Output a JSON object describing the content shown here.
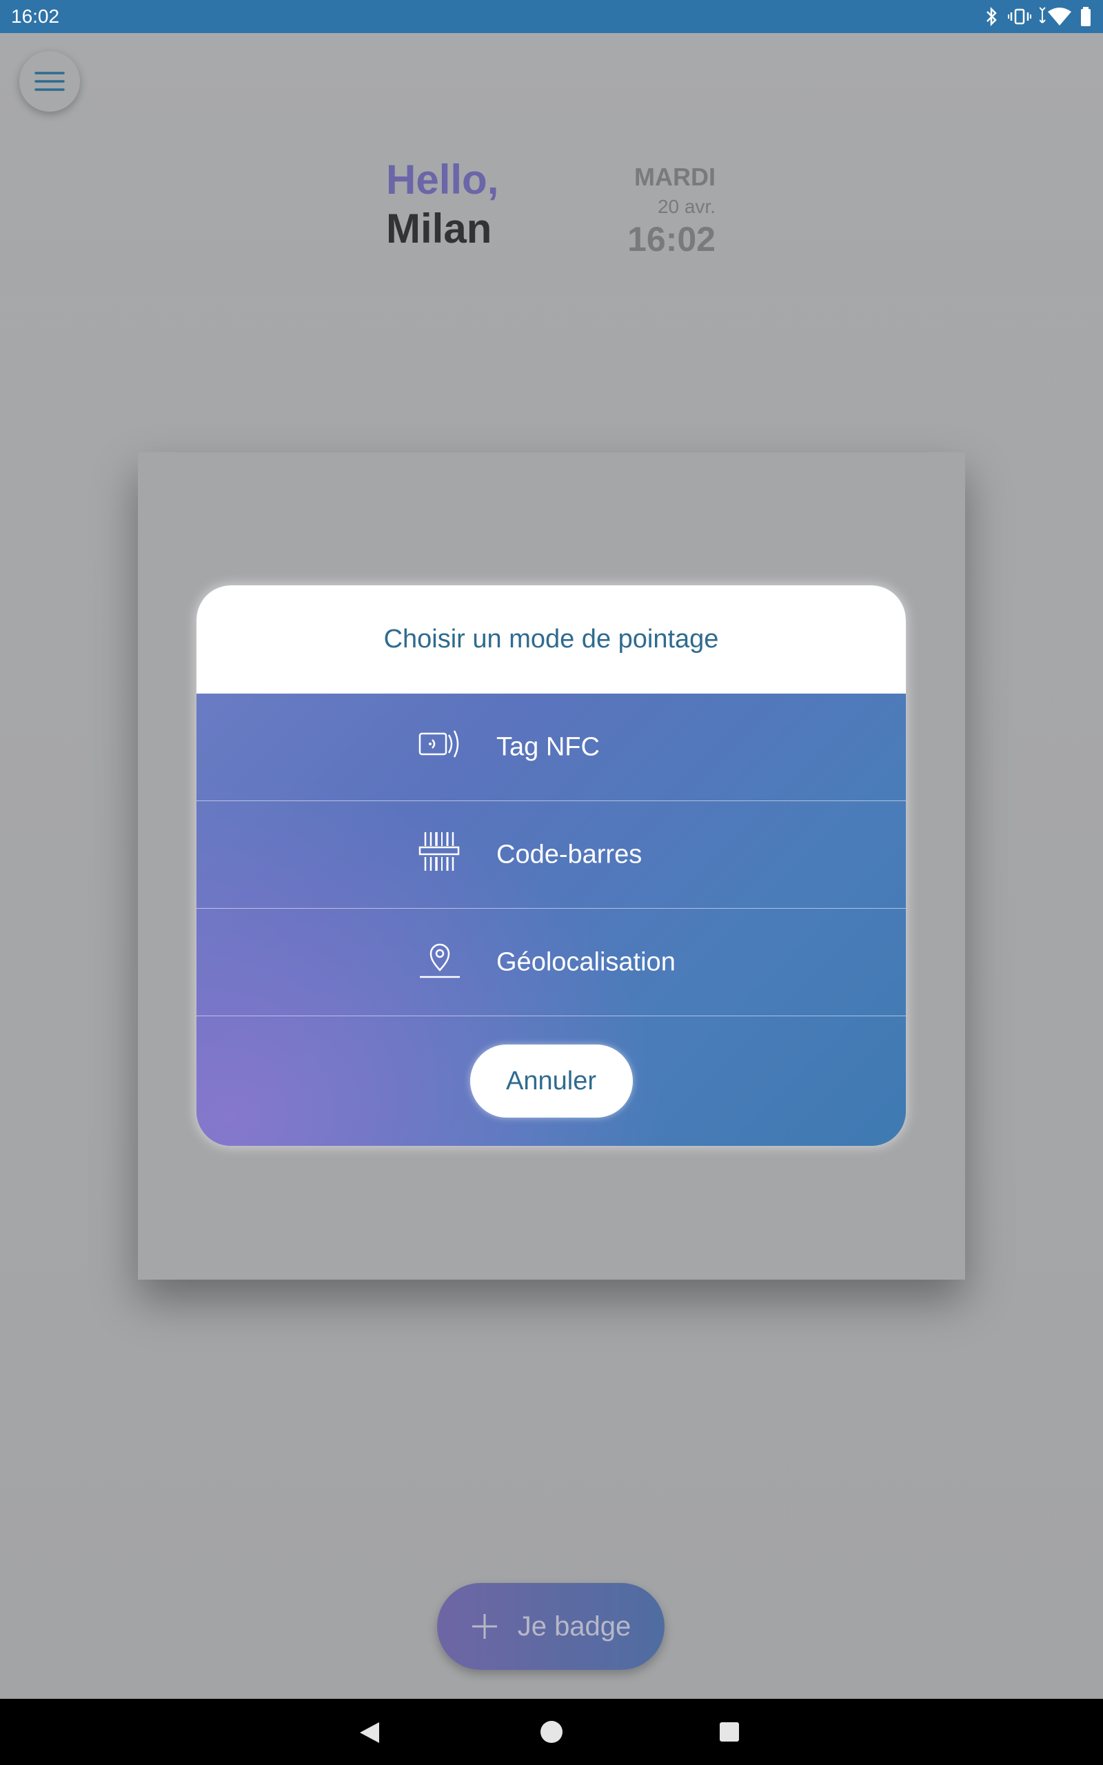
{
  "status_bar": {
    "time": "16:02",
    "icons": [
      "bluetooth-icon",
      "vibrate-icon",
      "wifi-icon",
      "battery-icon"
    ]
  },
  "header": {
    "hello": "Hello,",
    "name": "Milan",
    "day": "MARDI",
    "date": "20 avr.",
    "time": "16:02"
  },
  "dialog": {
    "title": "Choisir un mode de pointage",
    "options": [
      {
        "label": "Tag NFC",
        "icon": "nfc-icon"
      },
      {
        "label": "Code-barres",
        "icon": "barcode-icon"
      },
      {
        "label": "Géolocalisation",
        "icon": "location-pin-icon"
      }
    ],
    "cancel_label": "Annuler"
  },
  "fab": {
    "label": "Je badge",
    "icon": "plus-icon"
  },
  "colors": {
    "status_bar": "#2f74a8",
    "hello": "#6a66a8",
    "dialog_text": "#2f6b8f",
    "gradient_start": "#8a7ecb",
    "gradient_end": "#3f7ab2"
  }
}
